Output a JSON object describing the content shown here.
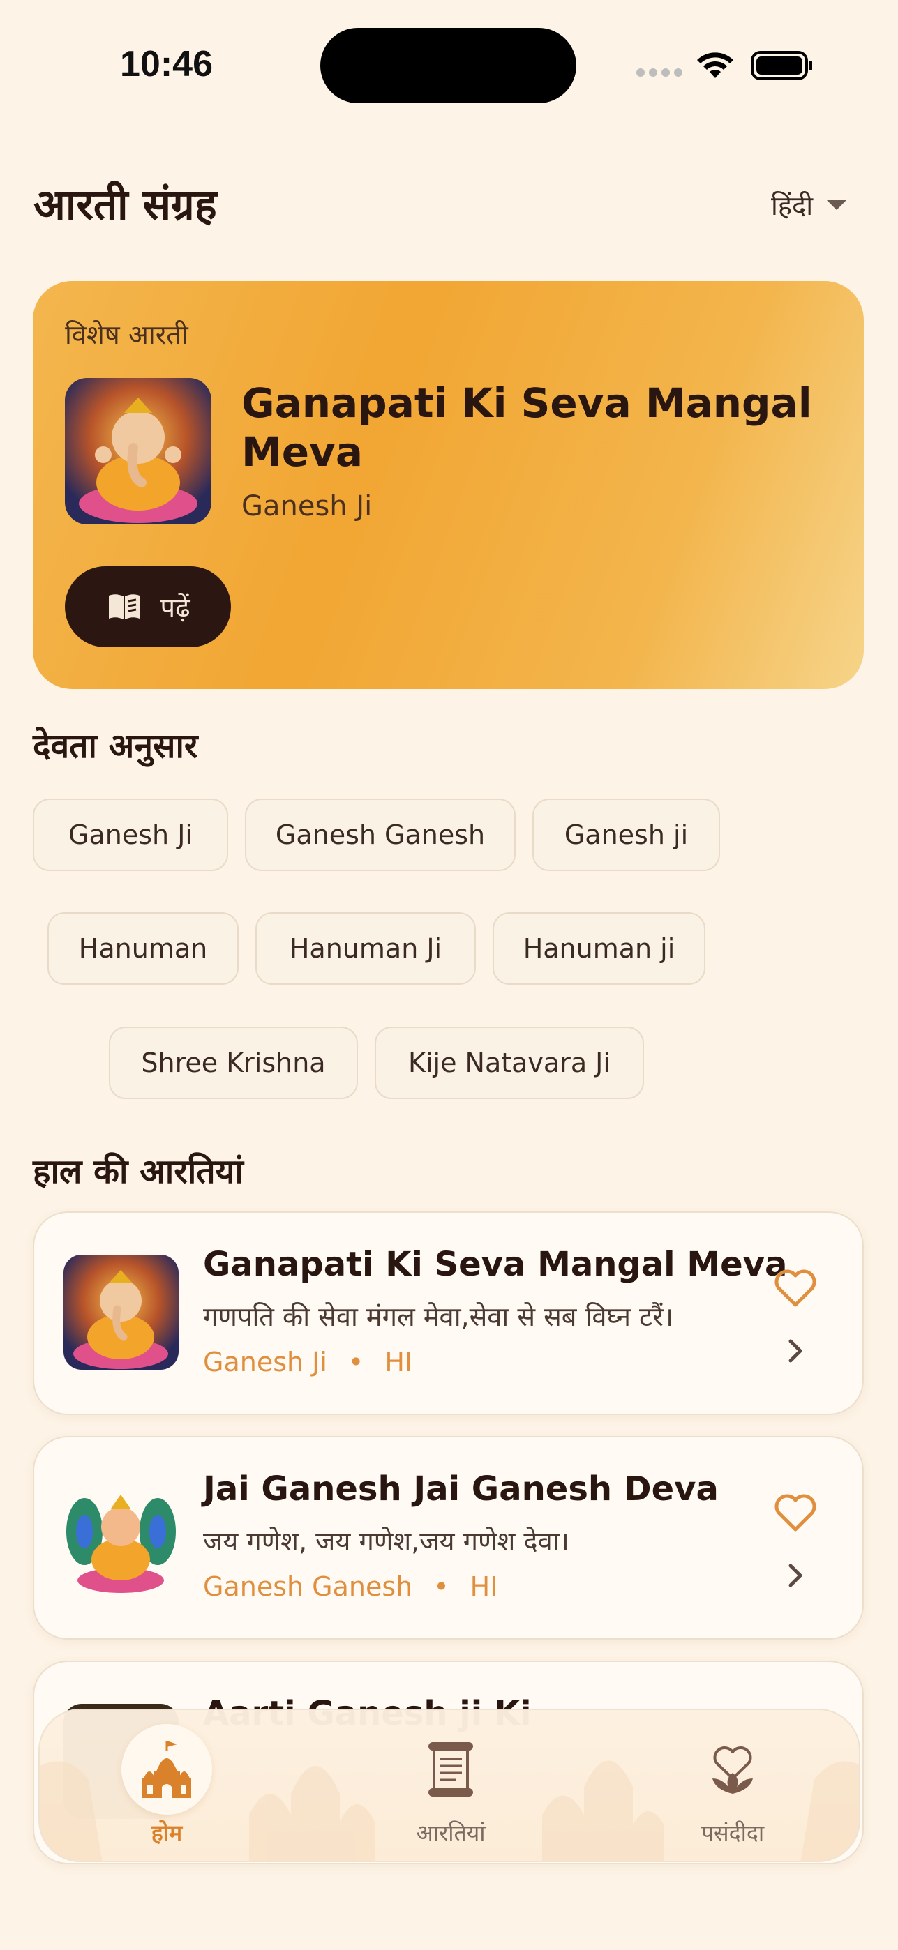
{
  "status_bar": {
    "time": "10:46"
  },
  "header": {
    "title": "आरती संग्रह",
    "language": "हिंदी"
  },
  "featured": {
    "label": "विशेष आरती",
    "title": "Ganapati Ki Seva Mangal Meva",
    "deity": "Ganesh Ji",
    "read_label": "पढ़ें"
  },
  "deities_section": {
    "title": "देवता अनुसार",
    "chips": [
      "Ganesh Ji",
      "Ganesh Ganesh",
      "Ganesh ji",
      "Hanuman",
      "Hanuman Ji",
      "Hanuman ji",
      "Shree Krishna",
      "Kije Natavara Ji"
    ]
  },
  "recent_section": {
    "title": "हाल की आरतियां",
    "items": [
      {
        "title": "Ganapati Ki Seva Mangal Meva",
        "line": "गणपति की सेवा मंगल मेवा,सेवा से सब विघ्न टरैं।",
        "deity": "Ganesh Ji",
        "dot": "•",
        "lang": "HI"
      },
      {
        "title": "Jai Ganesh Jai Ganesh Deva",
        "line": "जय गणेश, जय गणेश,जय गणेश देवा।",
        "deity": "Ganesh Ganesh",
        "dot": "•",
        "lang": "HI"
      },
      {
        "title": "Aarti Ganesh ji Ki",
        "line": "",
        "deity": "",
        "dot": "",
        "lang": ""
      }
    ]
  },
  "bottom_nav": {
    "items": [
      {
        "label": "होम",
        "icon": "temple-icon",
        "active": true
      },
      {
        "label": "आरतियां",
        "icon": "scroll-icon",
        "active": false
      },
      {
        "label": "पसंदीदा",
        "icon": "heart-lotus-icon",
        "active": false
      }
    ]
  },
  "colors": {
    "accent": "#e08f3e",
    "dark": "#2b1611",
    "background": "#fdf3e6"
  }
}
